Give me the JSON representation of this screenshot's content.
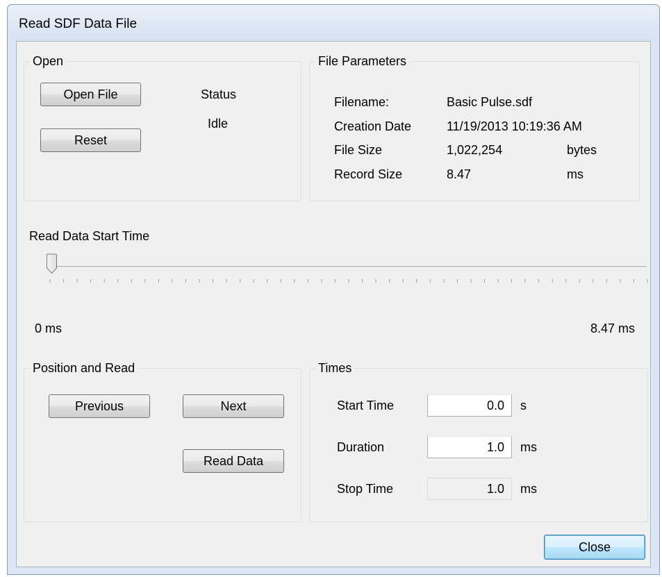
{
  "window": {
    "title": "Read SDF Data File"
  },
  "open_group": {
    "label": "Open",
    "open_button": "Open File",
    "reset_button": "Reset",
    "status_label": "Status",
    "status_value": "Idle"
  },
  "file_params": {
    "label": "File Parameters",
    "rows": [
      {
        "label": "Filename:",
        "value": "Basic Pulse.sdf",
        "unit": ""
      },
      {
        "label": "Creation Date",
        "value": "11/19/2013 10:19:36 AM",
        "unit": ""
      },
      {
        "label": "File Size",
        "value": "1,022,254",
        "unit": "bytes"
      },
      {
        "label": "Record Size",
        "value": "8.47",
        "unit": "ms"
      }
    ]
  },
  "slider": {
    "label": "Read Data Start Time",
    "min_label": "0 ms",
    "max_label": "8.47 ms",
    "value": 0,
    "min": 0,
    "max": 8.47,
    "tick_count": 45
  },
  "position_group": {
    "label": "Position and Read",
    "previous_button": "Previous",
    "next_button": "Next",
    "read_button": "Read Data"
  },
  "times_group": {
    "label": "Times",
    "start": {
      "label": "Start Time",
      "value": "0.0",
      "unit": "s"
    },
    "duration": {
      "label": "Duration",
      "value": "1.0",
      "unit": "ms"
    },
    "stop": {
      "label": "Stop Time",
      "value": "1.0",
      "unit": "ms"
    }
  },
  "footer": {
    "close_button": "Close"
  }
}
